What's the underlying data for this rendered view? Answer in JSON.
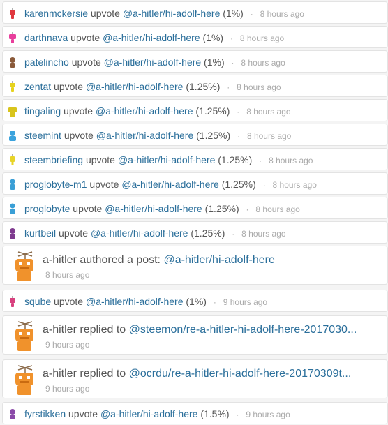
{
  "feed": {
    "items": [
      {
        "kind": "vote",
        "user": "karenmckersie",
        "action": "upvote",
        "link": "@a-hitler/hi-adolf-here",
        "weight": "(1%)",
        "time": "8 hours ago",
        "avatar_color": "#e0383f"
      },
      {
        "kind": "vote",
        "user": "darthnava",
        "action": "upvote",
        "link": "@a-hitler/hi-adolf-here",
        "weight": "(1%)",
        "time": "8 hours ago",
        "avatar_color": "#e83f9c"
      },
      {
        "kind": "vote",
        "user": "patelincho",
        "action": "upvote",
        "link": "@a-hitler/hi-adolf-here",
        "weight": "(1%)",
        "time": "8 hours ago",
        "avatar_color": "#8a5a3a"
      },
      {
        "kind": "vote",
        "user": "zentat",
        "action": "upvote",
        "link": "@a-hitler/hi-adolf-here",
        "weight": "(1.25%)",
        "time": "8 hours ago",
        "avatar_color": "#e6d21e"
      },
      {
        "kind": "vote",
        "user": "tingaling",
        "action": "upvote",
        "link": "@a-hitler/hi-adolf-here",
        "weight": "(1.25%)",
        "time": "8 hours ago",
        "avatar_color": "#d8c41c"
      },
      {
        "kind": "vote",
        "user": "steemint",
        "action": "upvote",
        "link": "@a-hitler/hi-adolf-here",
        "weight": "(1.25%)",
        "time": "8 hours ago",
        "avatar_color": "#3ba3dd"
      },
      {
        "kind": "vote",
        "user": "steembriefing",
        "action": "upvote",
        "link": "@a-hitler/hi-adolf-here",
        "weight": "(1.25%)",
        "time": "8 hours ago",
        "avatar_color": "#e8d428"
      },
      {
        "kind": "vote",
        "user": "proglobyte-m1",
        "action": "upvote",
        "link": "@a-hitler/hi-adolf-here",
        "weight": "(1.25%)",
        "time": "8 hours ago",
        "avatar_color": "#3a9fd6"
      },
      {
        "kind": "vote",
        "user": "proglobyte",
        "action": "upvote",
        "link": "@a-hitler/hi-adolf-here",
        "weight": "(1.25%)",
        "time": "8 hours ago",
        "avatar_color": "#3a9fd6"
      },
      {
        "kind": "vote",
        "user": "kurtbeil",
        "action": "upvote",
        "link": "@a-hitler/hi-adolf-here",
        "weight": "(1.25%)",
        "time": "8 hours ago",
        "avatar_color": "#7e3a8e"
      },
      {
        "kind": "post",
        "user": "a-hitler",
        "action": "authored a post:",
        "link": "@a-hitler/hi-adolf-here",
        "time": "8 hours ago",
        "avatar_color": "#f0922c"
      },
      {
        "kind": "vote",
        "user": "sqube",
        "action": "upvote",
        "link": "@a-hitler/hi-adolf-here",
        "weight": "(1%)",
        "time": "9 hours ago",
        "avatar_color": "#d8407e"
      },
      {
        "kind": "post",
        "user": "a-hitler",
        "action": "replied to",
        "link": "@steemon/re-a-hitler-hi-adolf-here-2017030...",
        "time": "9 hours ago",
        "avatar_color": "#f0922c"
      },
      {
        "kind": "post",
        "user": "a-hitler",
        "action": "replied to",
        "link": "@ocrdu/re-a-hitler-hi-adolf-here-20170309t...",
        "time": "9 hours ago",
        "avatar_color": "#f0922c"
      },
      {
        "kind": "vote",
        "user": "fyrstikken",
        "action": "upvote",
        "link": "@a-hitler/hi-adolf-here",
        "weight": "(1.5%)",
        "time": "9 hours ago",
        "avatar_color": "#8a4aa8"
      }
    ]
  }
}
